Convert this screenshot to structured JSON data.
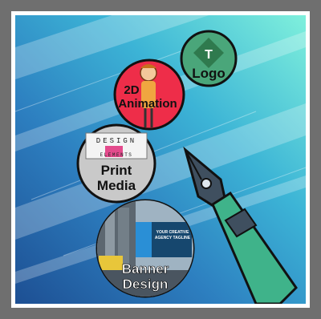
{
  "labels": {
    "logo": "Logo",
    "logo_mark": "T",
    "animation_1": "2D",
    "animation_2": "Animation",
    "print_1": "Print",
    "print_2": "Media",
    "design_top": "DESIGN",
    "design_bottom": "ELEMENTS",
    "banner_1": "Banner",
    "banner_2": "Design",
    "banner_headline_1": "YOUR CREATIVE",
    "banner_headline_2": "AGENCY TAGLINE"
  },
  "colors": {
    "background_gradient": [
      "#1f5f9e",
      "#2f8fc7",
      "#47c8d6",
      "#7fe6d8"
    ],
    "logo_circle": "#4aa67a",
    "logo_diamond": "#2f7a4e",
    "animation_circle": "#ee2d49",
    "print_circle": "#c9c9c9",
    "pen_nib": "#3f4f5f",
    "pen_body": "#3fb38a"
  }
}
